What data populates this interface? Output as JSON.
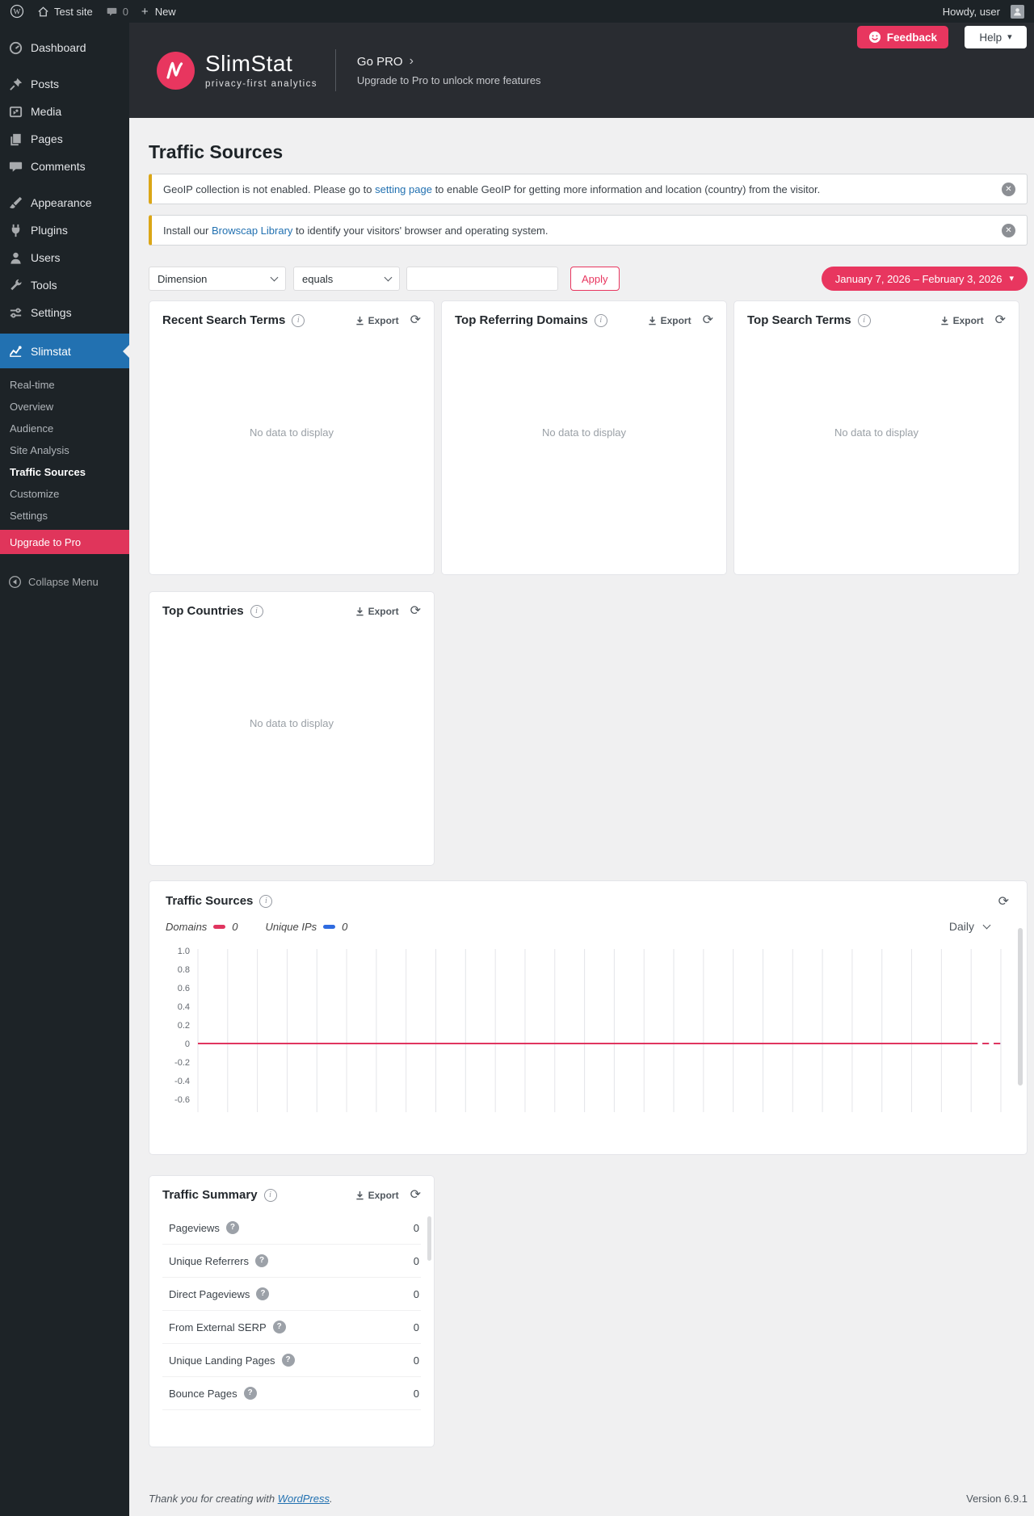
{
  "admin_bar": {
    "site_name": "Test site",
    "comments_count": "0",
    "new_label": "New",
    "howdy": "Howdy, user"
  },
  "sidebar": {
    "items": [
      {
        "label": "Dashboard"
      },
      {
        "label": "Posts"
      },
      {
        "label": "Media"
      },
      {
        "label": "Pages"
      },
      {
        "label": "Comments"
      },
      {
        "label": "Appearance"
      },
      {
        "label": "Plugins"
      },
      {
        "label": "Users"
      },
      {
        "label": "Tools"
      },
      {
        "label": "Settings"
      },
      {
        "label": "Slimstat"
      }
    ],
    "submenu": [
      {
        "label": "Real-time"
      },
      {
        "label": "Overview"
      },
      {
        "label": "Audience"
      },
      {
        "label": "Site Analysis"
      },
      {
        "label": "Traffic Sources"
      },
      {
        "label": "Customize"
      },
      {
        "label": "Settings"
      },
      {
        "label": "Upgrade to Pro"
      }
    ],
    "collapse_label": "Collapse Menu"
  },
  "header": {
    "brand_name": "SlimStat",
    "brand_tagline": "privacy-first analytics",
    "gopro_title": "Go PRO",
    "gopro_chevron": "›",
    "gopro_subtitle": "Upgrade to Pro to unlock more features",
    "feedback_label": "Feedback",
    "help_label": "Help"
  },
  "page": {
    "title": "Traffic Sources"
  },
  "notices": [
    {
      "before": "GeoIP collection is not enabled. Please go to ",
      "link": "setting page",
      "after": " to enable GeoIP for getting more information and location (country) from the visitor."
    },
    {
      "before": "Install our ",
      "link": "Browscap Library",
      "after": " to identify your visitors' browser and operating system."
    }
  ],
  "filters": {
    "dimension": "Dimension",
    "operator": "equals",
    "input_value": "",
    "apply_label": "Apply",
    "date_range": "January 7, 2026 – February 3, 2026"
  },
  "panels": [
    {
      "title": "Recent Search Terms",
      "export_label": "Export",
      "empty": "No data to display"
    },
    {
      "title": "Top Referring Domains",
      "export_label": "Export",
      "empty": "No data to display"
    },
    {
      "title": "Top Search Terms",
      "export_label": "Export",
      "empty": "No data to display"
    },
    {
      "title": "Top Countries",
      "export_label": "Export",
      "empty": "No data to display"
    }
  ],
  "chart_data": {
    "type": "line",
    "title": "Traffic Sources",
    "interval": "Daily",
    "x_start": "January 7, 2026",
    "x_end": "February 3, 2026",
    "num_points": 28,
    "series": [
      {
        "name": "Domains",
        "color": "#e0355f",
        "total": 0,
        "values": [
          0,
          0,
          0,
          0,
          0,
          0,
          0,
          0,
          0,
          0,
          0,
          0,
          0,
          0,
          0,
          0,
          0,
          0,
          0,
          0,
          0,
          0,
          0,
          0,
          0,
          0,
          0,
          0
        ]
      },
      {
        "name": "Unique IPs",
        "color": "#2f6be0",
        "total": 0,
        "values": [
          0,
          0,
          0,
          0,
          0,
          0,
          0,
          0,
          0,
          0,
          0,
          0,
          0,
          0,
          0,
          0,
          0,
          0,
          0,
          0,
          0,
          0,
          0,
          0,
          0,
          0,
          0,
          0
        ]
      }
    ],
    "yticks": [
      "1.0",
      "0.8",
      "0.6",
      "0.4",
      "0.2",
      "0",
      "-0.2",
      "-0.4",
      "-0.6"
    ],
    "ylim": [
      -0.7,
      1.05
    ],
    "grid": "vertical",
    "legend_position": "top-left",
    "dashed_tail": true
  },
  "traffic_summary": {
    "title": "Traffic Summary",
    "export_label": "Export",
    "rows": [
      {
        "label": "Pageviews",
        "value": "0"
      },
      {
        "label": "Unique Referrers",
        "value": "0"
      },
      {
        "label": "Direct Pageviews",
        "value": "0"
      },
      {
        "label": "From External SERP",
        "value": "0"
      },
      {
        "label": "Unique Landing Pages",
        "value": "0"
      },
      {
        "label": "Bounce Pages",
        "value": "0"
      }
    ]
  },
  "footer": {
    "before": "Thank you for creating with ",
    "link": "WordPress",
    "after": ".",
    "version": "Version 6.9.1"
  }
}
